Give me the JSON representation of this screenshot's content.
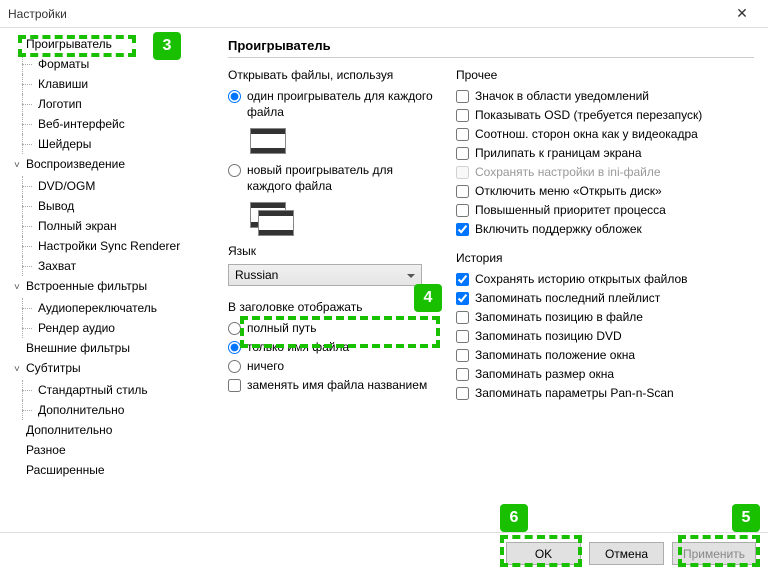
{
  "window": {
    "title": "Настройки"
  },
  "sidebar": {
    "items": [
      {
        "label": "Проигрыватель",
        "level": 1,
        "exp": ""
      },
      {
        "label": "Форматы",
        "level": 2
      },
      {
        "label": "Клавиши",
        "level": 2
      },
      {
        "label": "Логотип",
        "level": 2
      },
      {
        "label": "Веб-интерфейс",
        "level": 2
      },
      {
        "label": "Шейдеры",
        "level": 2
      },
      {
        "label": "Воспроизведение",
        "level": 1,
        "exp": "˅"
      },
      {
        "label": "DVD/OGM",
        "level": 2
      },
      {
        "label": "Вывод",
        "level": 2
      },
      {
        "label": "Полный экран",
        "level": 2
      },
      {
        "label": "Настройки Sync Renderer",
        "level": 2
      },
      {
        "label": "Захват",
        "level": 2
      },
      {
        "label": "Встроенные фильтры",
        "level": 1,
        "exp": "˅"
      },
      {
        "label": "Аудиопереключатель",
        "level": 2
      },
      {
        "label": "Рендер аудио",
        "level": 2
      },
      {
        "label": "Внешние фильтры",
        "level": 1,
        "exp": ""
      },
      {
        "label": "Субтитры",
        "level": 1,
        "exp": "˅"
      },
      {
        "label": "Стандартный стиль",
        "level": 2
      },
      {
        "label": "Дополнительно",
        "level": 2
      },
      {
        "label": "Дополнительно",
        "level": 1,
        "exp": ""
      },
      {
        "label": "Разное",
        "level": 1,
        "exp": ""
      },
      {
        "label": "Расширенные",
        "level": 1,
        "exp": ""
      }
    ]
  },
  "content": {
    "title": "Проигрыватель",
    "open_files": {
      "label": "Открывать файлы, используя",
      "opt1": "один проигрыватель для каждого файла",
      "opt2": "новый проигрыватель для каждого файла"
    },
    "language": {
      "label": "Язык",
      "value": "Russian"
    },
    "titlebar": {
      "label": "В заголовке отображать",
      "opt1": "полный путь",
      "opt2": "только имя файла",
      "opt3": "ничего",
      "replace": "заменять имя файла названием"
    },
    "other": {
      "label": "Прочее",
      "items": [
        {
          "label": "Значок в области уведомлений",
          "checked": false
        },
        {
          "label": "Показывать OSD (требуется перезапуск)",
          "checked": false
        },
        {
          "label": "Соотнош. сторон окна как у видеокадра",
          "checked": false
        },
        {
          "label": "Прилипать к границам экрана",
          "checked": false
        },
        {
          "label": "Сохранять настройки в ini-файле",
          "checked": false,
          "disabled": true
        },
        {
          "label": "Отключить меню «Открыть диск»",
          "checked": false
        },
        {
          "label": "Повышенный приоритет процесса",
          "checked": false
        },
        {
          "label": "Включить поддержку обложек",
          "checked": true
        }
      ]
    },
    "history": {
      "label": "История",
      "items": [
        {
          "label": "Сохранять историю открытых файлов",
          "checked": true
        },
        {
          "label": "Запоминать последний плейлист",
          "checked": true
        },
        {
          "label": "Запоминать позицию в файле",
          "checked": false
        },
        {
          "label": "Запоминать позицию DVD",
          "checked": false
        },
        {
          "label": "Запоминать положение окна",
          "checked": false
        },
        {
          "label": "Запоминать размер окна",
          "checked": false
        },
        {
          "label": "Запоминать параметры Pan-n-Scan",
          "checked": false
        }
      ]
    }
  },
  "buttons": {
    "ok": "OK",
    "cancel": "Отмена",
    "apply": "Применить"
  },
  "badges": {
    "b3": "3",
    "b4": "4",
    "b5": "5",
    "b6": "6"
  }
}
